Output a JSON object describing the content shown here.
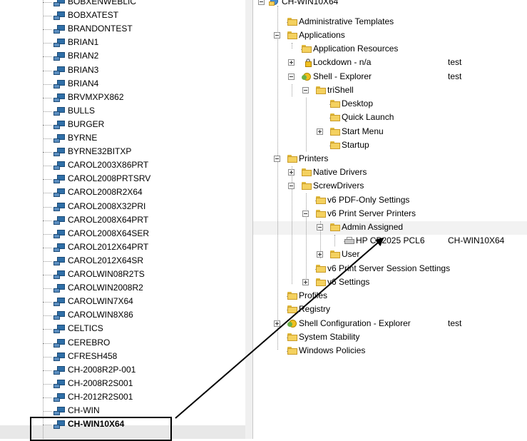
{
  "left_tree": {
    "items": [
      {
        "label": "BOBXENWEBLIC"
      },
      {
        "label": "BOBXATEST"
      },
      {
        "label": "BRANDONTEST"
      },
      {
        "label": "BRIAN1"
      },
      {
        "label": "BRIAN2"
      },
      {
        "label": "BRIAN3"
      },
      {
        "label": "BRIAN4"
      },
      {
        "label": "BRVMXPX862"
      },
      {
        "label": "BULLS"
      },
      {
        "label": "BURGER"
      },
      {
        "label": "BYRNE"
      },
      {
        "label": "BYRNE32BITXP"
      },
      {
        "label": "CAROL2003X86PRT"
      },
      {
        "label": "CAROL2008PRTSRV"
      },
      {
        "label": "CAROL2008R2X64"
      },
      {
        "label": "CAROL2008X32PRI"
      },
      {
        "label": "CAROL2008X64PRT"
      },
      {
        "label": "CAROL2008X64SER"
      },
      {
        "label": "CAROL2012X64PRT"
      },
      {
        "label": "CAROL2012X64SR"
      },
      {
        "label": "CAROLWIN08R2TS"
      },
      {
        "label": "CAROLWIN2008R2"
      },
      {
        "label": "CAROLWIN7X64"
      },
      {
        "label": "CAROLWIN8X86"
      },
      {
        "label": "CELTICS"
      },
      {
        "label": "CEREBRO"
      },
      {
        "label": "CFRESH458"
      },
      {
        "label": "CH-2008R2P-001"
      },
      {
        "label": "CH-2008R2S001"
      },
      {
        "label": "CH-2012R2S001"
      },
      {
        "label": "CH-WIN"
      },
      {
        "label": "CH-WIN10X64",
        "selected": true
      }
    ]
  },
  "right_tree": {
    "root": {
      "label": "CH-WIN10X64"
    },
    "items": [
      {
        "key": "admin_templates",
        "label": "Administrative Templates",
        "col": ""
      },
      {
        "key": "applications",
        "label": "Applications",
        "col": ""
      },
      {
        "key": "app_resources",
        "label": "Application Resources",
        "col": ""
      },
      {
        "key": "lockdown",
        "label": "Lockdown - n/a",
        "col": "test"
      },
      {
        "key": "shell_explorer",
        "label": "Shell - Explorer",
        "col": "test"
      },
      {
        "key": "trishell",
        "label": "triShell",
        "col": ""
      },
      {
        "key": "desktop",
        "label": "Desktop",
        "col": ""
      },
      {
        "key": "quick_launch",
        "label": "Quick Launch",
        "col": ""
      },
      {
        "key": "start_menu",
        "label": "Start Menu",
        "col": ""
      },
      {
        "key": "startup",
        "label": "Startup",
        "col": ""
      },
      {
        "key": "printers",
        "label": "Printers",
        "col": ""
      },
      {
        "key": "native_drivers",
        "label": "Native Drivers",
        "col": ""
      },
      {
        "key": "screwdrivers",
        "label": "ScrewDrivers",
        "col": ""
      },
      {
        "key": "v6_pdf",
        "label": "v6 PDF-Only Settings",
        "col": ""
      },
      {
        "key": "v6_print_server",
        "label": "v6 Print Server Printers",
        "col": ""
      },
      {
        "key": "admin_assigned",
        "label": "Admin Assigned",
        "col": ""
      },
      {
        "key": "hp_printer",
        "label": "HP CP2025 PCL6",
        "col": "CH-WIN10X64"
      },
      {
        "key": "user",
        "label": "User",
        "col": ""
      },
      {
        "key": "v6_session",
        "label": "v6 Print Server Session Settings",
        "col": ""
      },
      {
        "key": "v6_settings",
        "label": "v6 Settings",
        "col": ""
      },
      {
        "key": "profiles",
        "label": "Profiles",
        "col": ""
      },
      {
        "key": "registry",
        "label": "Registry",
        "col": ""
      },
      {
        "key": "shell_config",
        "label": "Shell Configuration - Explorer",
        "col": "test"
      },
      {
        "key": "system_stability",
        "label": "System Stability",
        "col": ""
      },
      {
        "key": "windows_policies",
        "label": "Windows Policies",
        "col": ""
      }
    ]
  },
  "annotation": {
    "color": "#000000"
  }
}
